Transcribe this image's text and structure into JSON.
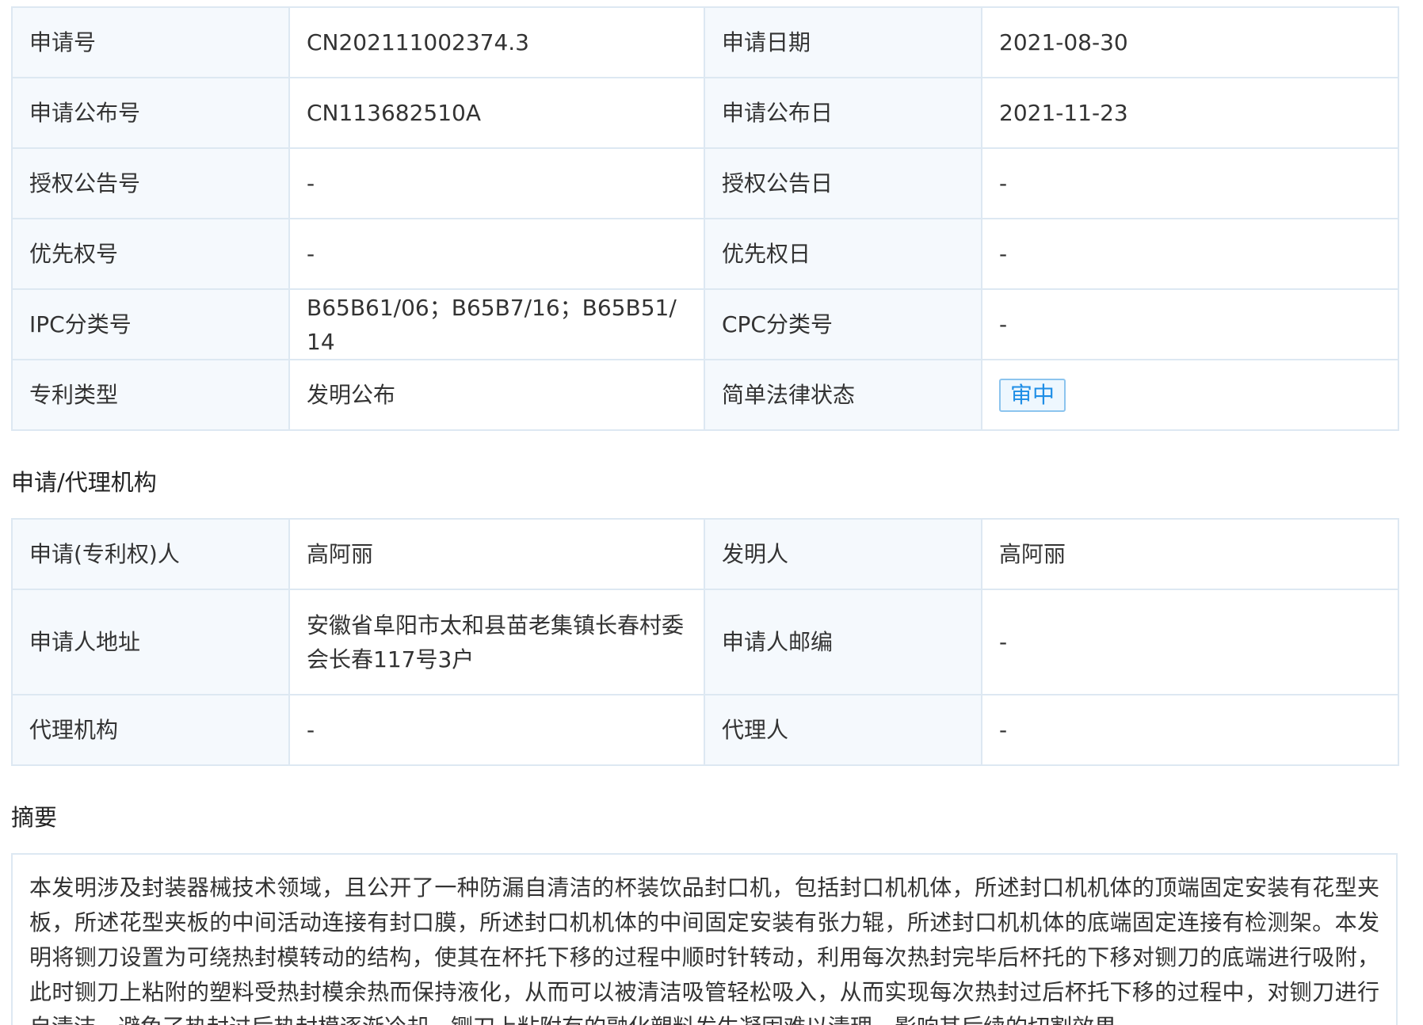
{
  "basic_info": {
    "rows": [
      {
        "label1": "申请号",
        "value1": "CN202111002374.3",
        "label2": "申请日期",
        "value2": "2021-08-30"
      },
      {
        "label1": "申请公布号",
        "value1": "CN113682510A",
        "label2": "申请公布日",
        "value2": "2021-11-23"
      },
      {
        "label1": "授权公告号",
        "value1": "-",
        "label2": "授权公告日",
        "value2": "-"
      },
      {
        "label1": "优先权号",
        "value1": "-",
        "label2": "优先权日",
        "value2": "-"
      },
      {
        "label1": "IPC分类号",
        "value1": "B65B61/06；B65B7/16；B65B51/14",
        "label2": "CPC分类号",
        "value2": "-"
      },
      {
        "label1": "专利类型",
        "value1": "发明公布",
        "label2": "简单法律状态",
        "value2": "审中"
      }
    ]
  },
  "agency_section": {
    "title": "申请/代理机构",
    "rows": [
      {
        "label1": "申请(专利权)人",
        "value1": "高阿丽",
        "label2": "发明人",
        "value2": "高阿丽"
      },
      {
        "label1": "申请人地址",
        "value1": "安徽省阜阳市太和县苗老集镇长春村委会长春117号3户",
        "label2": "申请人邮编",
        "value2": "-"
      },
      {
        "label1": "代理机构",
        "value1": "-",
        "label2": "代理人",
        "value2": "-"
      }
    ]
  },
  "abstract_section": {
    "title": "摘要",
    "text": "本发明涉及封装器械技术领域，且公开了一种防漏自清洁的杯装饮品封口机，包括封口机机体，所述封口机机体的顶端固定安装有花型夹板，所述花型夹板的中间活动连接有封口膜，所述封口机机体的中间固定安装有张力辊，所述封口机机体的底端固定连接有检测架。本发明将铡刀设置为可绕热封模转动的结构，使其在杯托下移的过程中顺时针转动，利用每次热封完毕后杯托的下移对铡刀的底端进行吸附，此时铡刀上粘附的塑料受热封模余热而保持液化，从而可以被清洁吸管轻松吸入，从而实现每次热封过后杯托下移的过程中，对铡刀进行自清洁，避免了热封过后热封模逐渐冷却，铡刀上粘附有的融化塑料发生凝固难以清理，影响其后续的切割效果。"
  },
  "colors": {
    "label_bg": "#f5f9fd",
    "border": "#dde8f2",
    "badge_text": "#1f8ee6",
    "badge_border": "#8cc4ee",
    "badge_bg": "#eef7fe"
  }
}
